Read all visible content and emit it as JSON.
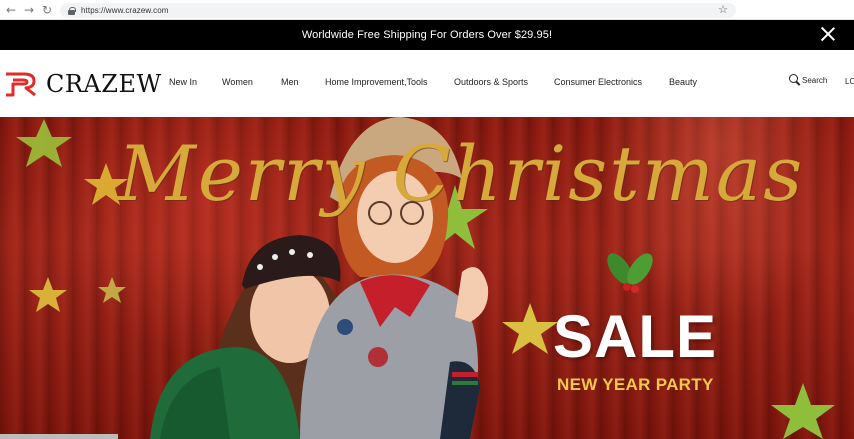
{
  "browser": {
    "url": "https://www.crazew.com",
    "icons": {
      "back": "arrow-left-icon",
      "forward": "arrow-right-icon",
      "reload": "reload-icon",
      "secure": "lock-icon",
      "bookmark": "star-icon"
    }
  },
  "announcement": {
    "text": "Worldwide Free Shipping For Orders Over $29.95!",
    "close_icon": "close-icon"
  },
  "header": {
    "logo_text": "CRAZEW",
    "brand_color": "#e22a2a",
    "nav": [
      "New In",
      "Women",
      "Men",
      "Home Improvement,Tools",
      "Outdoors & Sports",
      "Consumer Electronics",
      "Beauty"
    ],
    "search_label": "Search",
    "login_label": "LO"
  },
  "hero": {
    "script_text": "Merry Christmas",
    "sale_text": "SALE",
    "subtitle": "NEW YEAR PARTY",
    "accent_color": "#f2c84b"
  }
}
